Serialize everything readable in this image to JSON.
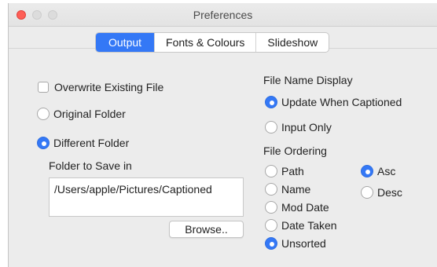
{
  "window": {
    "title": "Preferences"
  },
  "tabs": [
    {
      "label": "Output",
      "active": true
    },
    {
      "label": "Fonts & Colours",
      "active": false
    },
    {
      "label": "Slideshow",
      "active": false
    }
  ],
  "output": {
    "overwrite_label": "Overwrite Existing File",
    "overwrite_checked": false,
    "original_folder_label": "Original Folder",
    "different_folder_label": "Different Folder",
    "selected_destination": "Different Folder",
    "folder_to_save_label": "Folder to Save in",
    "folder_path": "/Users/apple/Pictures/Captioned",
    "browse_label": "Browse.."
  },
  "file_name_display": {
    "heading": "File Name Display",
    "options": [
      "Update When Captioned",
      "Input Only"
    ],
    "selected": "Update When Captioned"
  },
  "file_ordering": {
    "heading": "File Ordering",
    "fields": [
      "Path",
      "Name",
      "Mod Date",
      "Date Taken",
      "Unsorted"
    ],
    "selected_field": "Unsorted",
    "directions": [
      "Asc",
      "Desc"
    ],
    "selected_direction": "Asc"
  },
  "colors": {
    "accent": "#3478f6",
    "close": "#fe5f57"
  }
}
